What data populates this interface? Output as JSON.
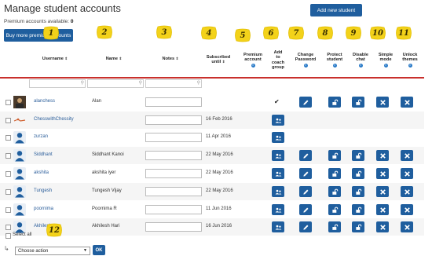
{
  "page": {
    "title": "Manage student accounts",
    "premium_label": "Premium accounts available:",
    "premium_count": "0",
    "buy_button": "Buy more premium accounts",
    "add_button": "Add new student"
  },
  "columns": {
    "username": "Username",
    "name": "Name",
    "notes": "Notes",
    "subscribed_line1": "Subscribed",
    "subscribed_line2": "until",
    "premium_line1": "Premium",
    "premium_line2": "account",
    "coach_line1": "Add",
    "coach_line2": "to",
    "coach_line3": "coach",
    "coach_line4": "group",
    "password_line1": "Change",
    "password_line2": "Password",
    "protect_line1": "Protect",
    "protect_line2": "student",
    "chat_line1": "Disable",
    "chat_line2": "chat",
    "simple_line1": "Simple",
    "simple_line2": "mode",
    "themes_line1": "Unlock",
    "themes_line2": "themes",
    "sort_glyph": "⇕",
    "info_glyph": "i"
  },
  "students": [
    {
      "username": "alanchess",
      "name": "Alan",
      "subscribed": "",
      "avatar": "photo"
    },
    {
      "username": "ChesswithChessity",
      "name": "",
      "subscribed": "16 Feb 2016",
      "avatar": "pic2"
    },
    {
      "username": "zurzan",
      "name": "",
      "subscribed": "11 Apr 2016",
      "avatar": "user"
    },
    {
      "username": "Siddhant",
      "name": "Siddhant Kanoi",
      "subscribed": "22 May 2016",
      "avatar": "user"
    },
    {
      "username": "akshita",
      "name": "akshita iyer",
      "subscribed": "22 May 2016",
      "avatar": "user"
    },
    {
      "username": "Tungesh",
      "name": "Tungesh Vijay",
      "subscribed": "22 May 2016",
      "avatar": "user"
    },
    {
      "username": "poornima",
      "name": "Poornima R",
      "subscribed": "11 Jun 2016",
      "avatar": "user"
    },
    {
      "username": "Akhilesh",
      "name": "Akhilesh Hari",
      "subscribed": "16 Jun 2016",
      "avatar": "user"
    }
  ],
  "footer": {
    "select_all": "Select all",
    "action_select": "Choose action",
    "ok_button": "OK"
  },
  "markers": [
    "1",
    "2",
    "3",
    "4",
    "5",
    "6",
    "7",
    "8",
    "9",
    "10",
    "11",
    "12"
  ],
  "colors": {
    "primary": "#1f5e9e",
    "divider": "#c9302c",
    "marker": "#f3d21a",
    "link": "#2a5d9a"
  }
}
